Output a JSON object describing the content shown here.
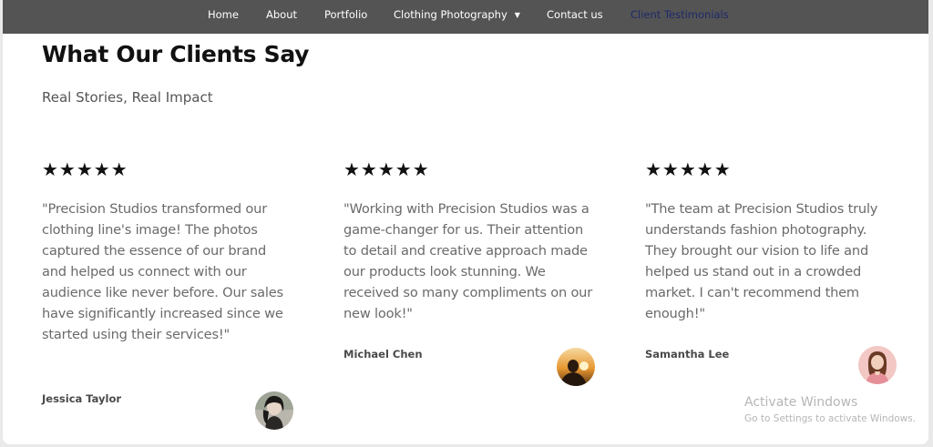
{
  "nav": {
    "items": [
      {
        "label": "Home"
      },
      {
        "label": "About"
      },
      {
        "label": "Portfolio"
      },
      {
        "label": "Clothing Photography"
      },
      {
        "label": "Contact us"
      },
      {
        "label": "Client Testimonials"
      }
    ],
    "active_color": "#1f2a6b"
  },
  "section": {
    "title": "What Our Clients Say",
    "subtitle": "Real Stories, Real Impact"
  },
  "testimonials": [
    {
      "stars": "★★★★★",
      "rating": 5,
      "quote": "\"Precision Studios transformed our clothing line's image! The photos captured the essence of our brand and helped us connect with our audience like never before. Our sales have significantly increased since we started using their services!\"",
      "name": "Jessica Taylor",
      "avatar_icon": "woman-portrait-avatar"
    },
    {
      "stars": "★★★★★",
      "rating": 5,
      "quote": "\"Working with Precision Studios was a game-changer for us. Their attention to detail and creative approach made our products look stunning. We received so many compliments on our new look!\"",
      "name": "Michael Chen",
      "avatar_icon": "sunset-silhouette-avatar"
    },
    {
      "stars": "★★★★★",
      "rating": 5,
      "quote": "\"The team at Precision Studios truly understands fashion photography. They brought our vision to life and helped us stand out in a crowded market. I can't recommend them enough!\"",
      "name": "Samantha Lee",
      "avatar_icon": "woman-pink-avatar"
    }
  ],
  "watermark": {
    "title": "Activate Windows",
    "subtitle": "Go to Settings to activate Windows."
  },
  "colors": {
    "nav_bg": "#545454",
    "page_bg": "#ffffff",
    "text_dark": "#111111",
    "text_body": "#6a6a6a"
  }
}
